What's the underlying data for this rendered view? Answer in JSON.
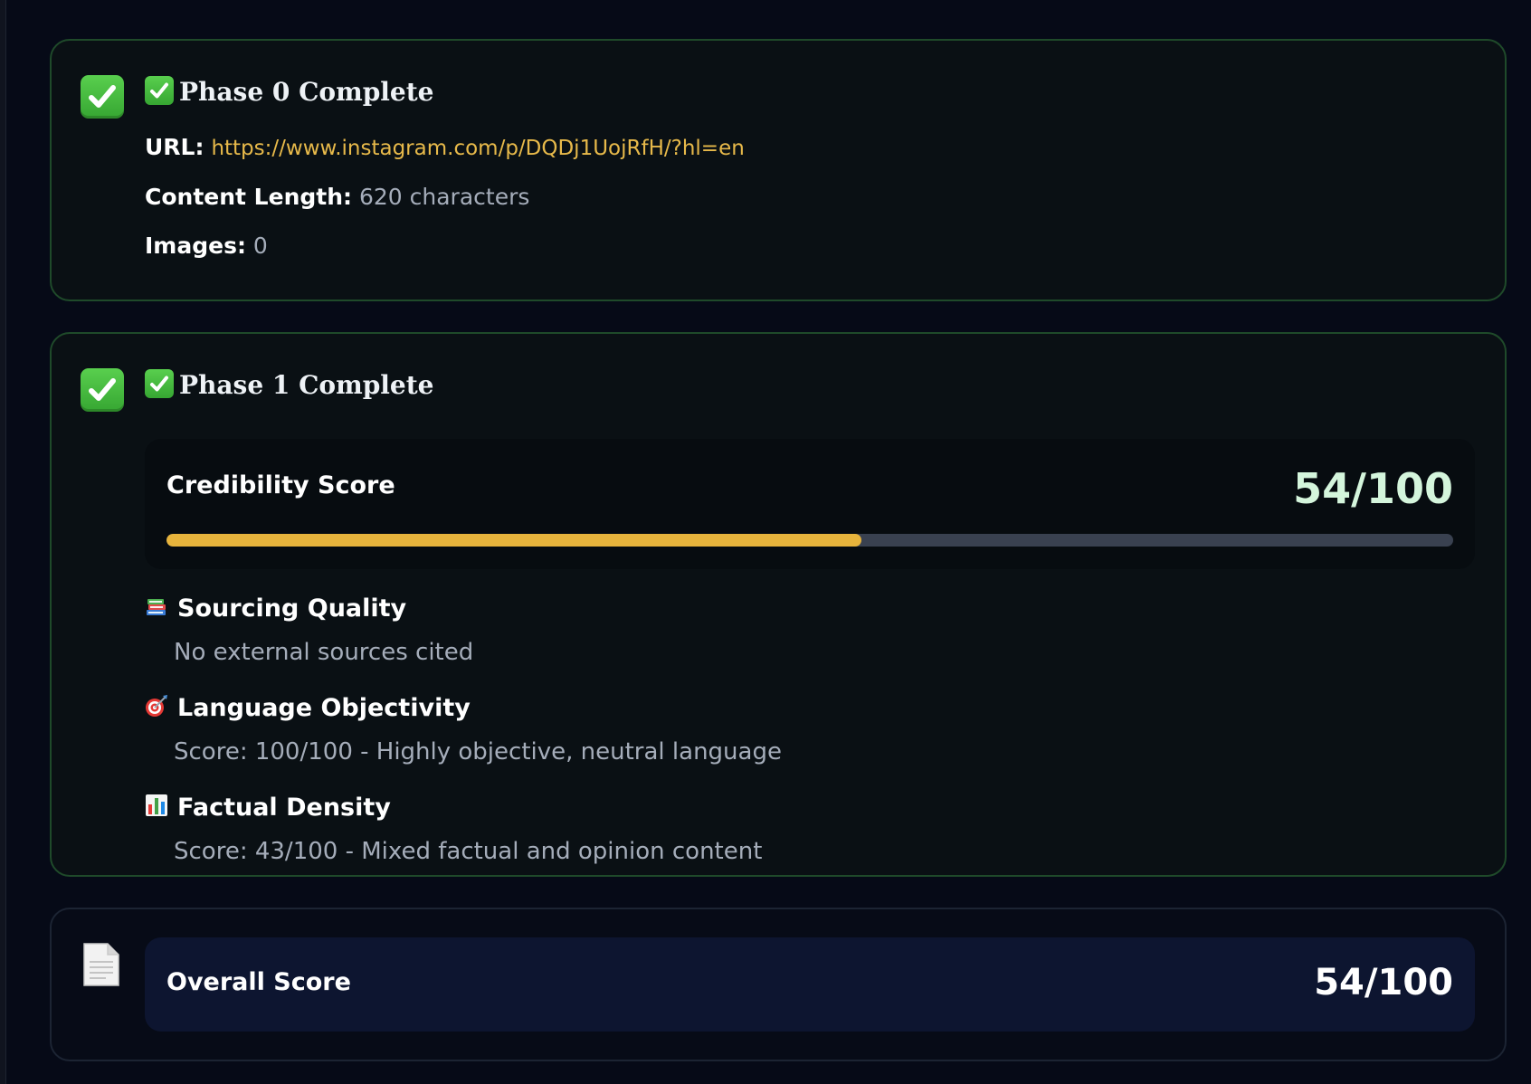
{
  "phase0": {
    "title": "Phase 0 Complete",
    "check_icon": "check-mark-button-icon",
    "url_label": "URL:",
    "url_value": "https://www.instagram.com/p/DQDj1UojRfH/?hl=en",
    "content_length_label": "Content Length:",
    "content_length_value": "620 characters",
    "images_label": "Images:",
    "images_value": "0"
  },
  "phase1": {
    "title": "Phase 1 Complete",
    "check_icon": "check-mark-button-icon",
    "credibility_label": "Credibility Score",
    "credibility_value": "54/100",
    "credibility_fraction": 0.54,
    "metrics": [
      {
        "icon": "books-icon",
        "title": "Sourcing Quality",
        "desc": "No external sources cited"
      },
      {
        "icon": "direct-hit-target-icon",
        "title": "Language Objectivity",
        "desc": "Score: 100/100 - Highly objective, neutral language"
      },
      {
        "icon": "bar-chart-icon",
        "title": "Factual Density",
        "desc": "Score: 43/100 - Mixed factual and opinion content"
      }
    ]
  },
  "overall": {
    "icon": "document-icon",
    "label": "Overall Score",
    "value": "54/100"
  },
  "colors": {
    "background": "#060a17",
    "card_border_success": "#1f4a2a",
    "link": "#e7b94a",
    "progress_fill": "#e7b43c",
    "progress_track": "#394150",
    "success_green": "#4cbf45"
  }
}
